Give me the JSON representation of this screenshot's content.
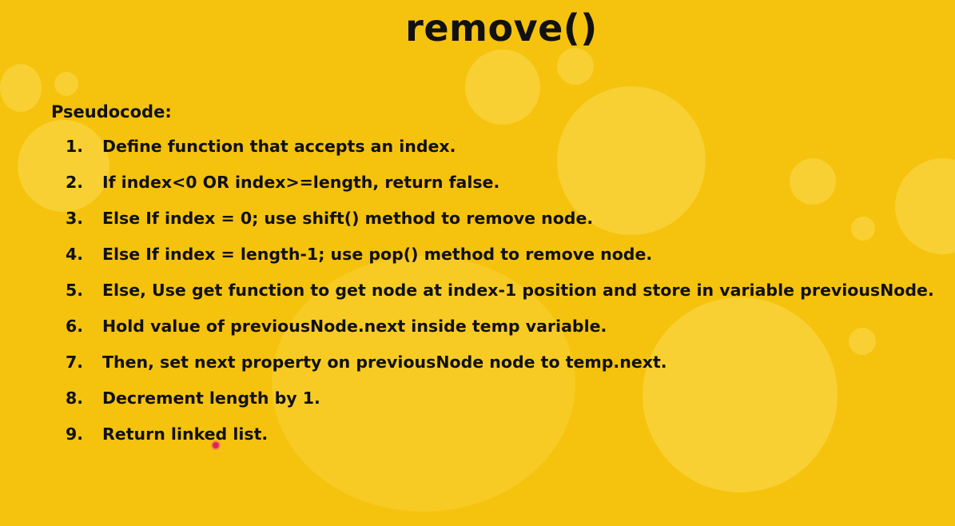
{
  "slide": {
    "title": "remove()",
    "subtitle": "Pseudocode:"
  },
  "steps": [
    {
      "num": "1.",
      "text": "Define function that accepts an index."
    },
    {
      "num": "2.",
      "text": "If index<0 OR index>=length, return false."
    },
    {
      "num": "3.",
      "text": "Else If index = 0; use shift() method to remove node."
    },
    {
      "num": "4.",
      "text": "Else If index = length-1; use pop() method to remove node."
    },
    {
      "num": "5.",
      "text": "Else, Use get function to get node at index-1 position and store in variable previousNode."
    },
    {
      "num": "6.",
      "text": "Hold value of previousNode.next inside temp variable."
    },
    {
      "num": "7.",
      "text": "Then, set next property on previousNode node to temp.next."
    },
    {
      "num": "8.",
      "text": "Decrement length by 1."
    },
    {
      "num": "9.",
      "text": "Return linked list."
    }
  ],
  "colors": {
    "background": "#f5c20e",
    "text": "#111111",
    "cursor": "#e0245e"
  }
}
